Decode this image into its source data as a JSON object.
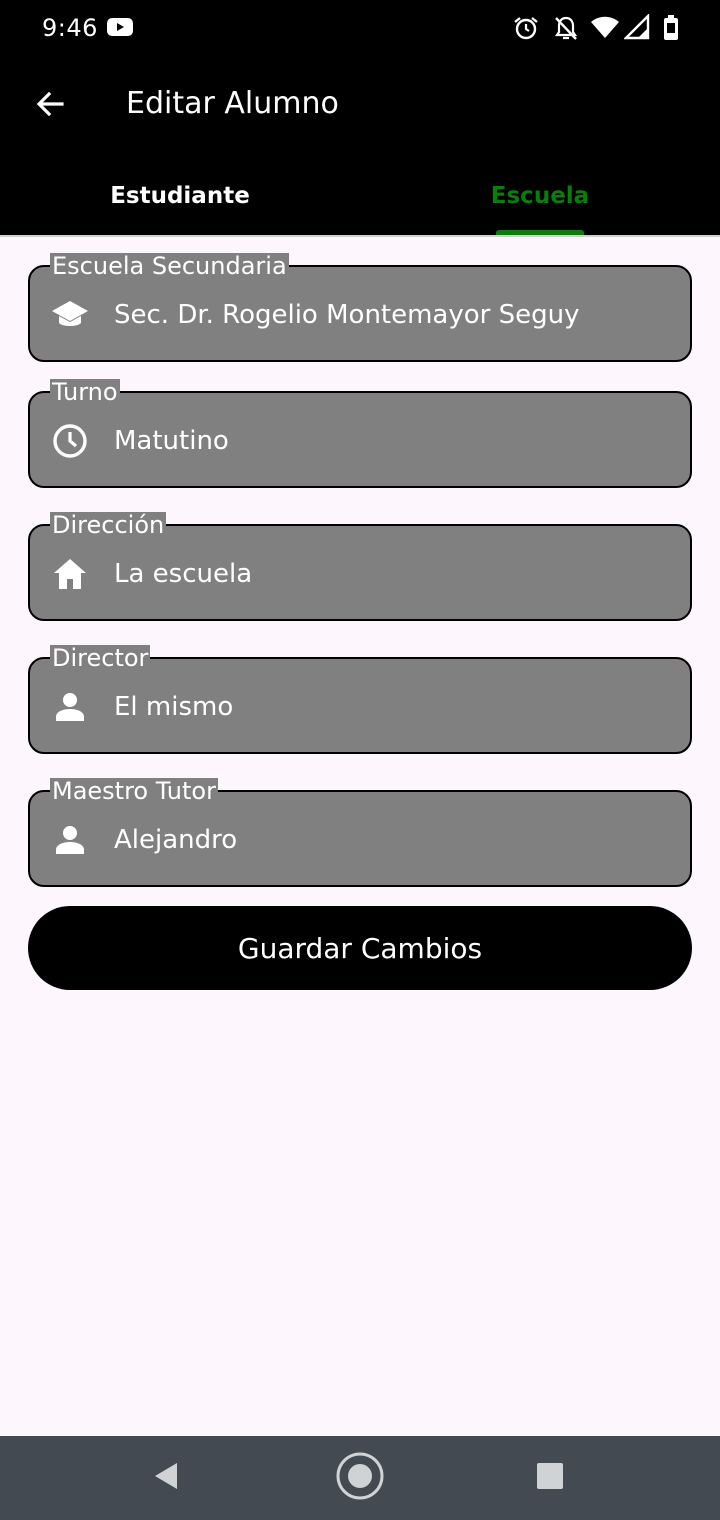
{
  "status_bar": {
    "time": "9:46",
    "icons": [
      "youtube-icon",
      "alarm-icon",
      "notifications-off-icon",
      "wifi-icon",
      "signal-icon",
      "battery-icon"
    ]
  },
  "app_bar": {
    "title": "Editar Alumno",
    "back_icon": "arrow-back-icon"
  },
  "tabs": [
    {
      "label": "Estudiante",
      "selected": false
    },
    {
      "label": "Escuela",
      "selected": true
    }
  ],
  "form": {
    "fields": [
      {
        "label": "Escuela Secundaria",
        "value": "Sec. Dr. Rogelio Montemayor Seguy",
        "icon": "school-icon"
      },
      {
        "label": "Turno",
        "value": "Matutino",
        "icon": "clock-icon"
      },
      {
        "label": "Dirección",
        "value": "La escuela",
        "icon": "home-icon"
      },
      {
        "label": "Director",
        "value": "El mismo",
        "icon": "person-icon"
      },
      {
        "label": "Maestro Tutor",
        "value": "Alejandro",
        "icon": "person-icon"
      }
    ],
    "save_label": "Guardar Cambios"
  },
  "colors": {
    "app_bar_bg": "#000000",
    "selected_tab": "#0a7d0a",
    "field_bg": "#808080",
    "page_bg": "#fdf6fd",
    "nav_bar_bg": "#434a52"
  },
  "nav_bar": {
    "buttons": [
      "nav-back-icon",
      "nav-home-icon",
      "nav-recents-icon"
    ]
  }
}
